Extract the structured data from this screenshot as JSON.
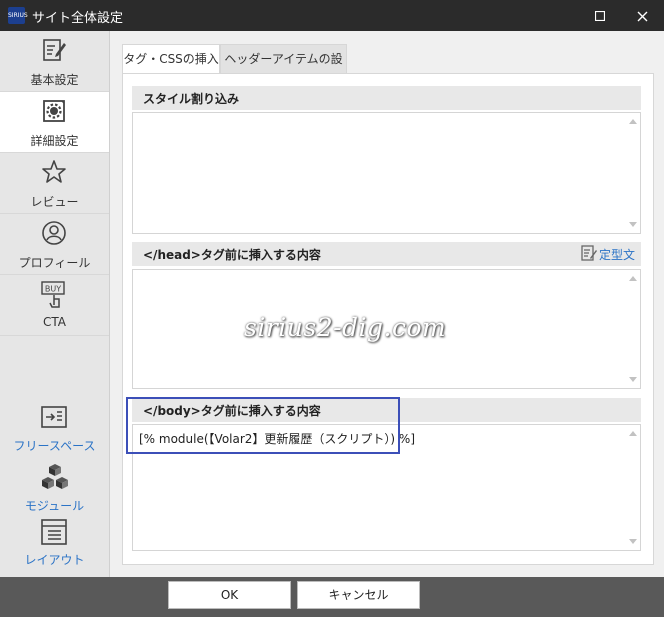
{
  "window": {
    "title": "サイト全体設定",
    "app_icon_text": "SIRIUS"
  },
  "sidebar": {
    "items": [
      {
        "label": "基本設定",
        "icon": "edit-document-icon"
      },
      {
        "label": "詳細設定",
        "icon": "settings-document-icon",
        "active": true
      },
      {
        "label": "レビュー",
        "icon": "star-icon"
      },
      {
        "label": "プロフィール",
        "icon": "user-icon"
      },
      {
        "label": "CTA",
        "icon": "buy-button-icon"
      }
    ],
    "bottom_items": [
      {
        "label": "フリースペース",
        "icon": "free-space-icon"
      },
      {
        "label": "モジュール",
        "icon": "cubes-icon"
      },
      {
        "label": "レイアウト",
        "icon": "layout-icon"
      }
    ]
  },
  "tabs": [
    {
      "label": "タグ・CSSの挿入",
      "active": true
    },
    {
      "label": "ヘッダーアイテムの設定",
      "active": false
    }
  ],
  "sections": [
    {
      "title": "スタイル割り込み",
      "value": ""
    },
    {
      "title": "</head>タグ前に挿入する内容",
      "value": "",
      "action_label": "定型文"
    },
    {
      "title": "</body>タグ前に挿入する内容",
      "value": "[% module(【Volar2】更新履歴（スクリプト）) %]"
    }
  ],
  "watermark": "sirius2-dig.com",
  "buttons": {
    "ok": "OK",
    "cancel": "キャンセル"
  },
  "colors": {
    "titlebar": "#2b2b2b",
    "accent_link": "#2b73c6",
    "highlight_border": "#3c4fb8",
    "footer": "#595959"
  }
}
